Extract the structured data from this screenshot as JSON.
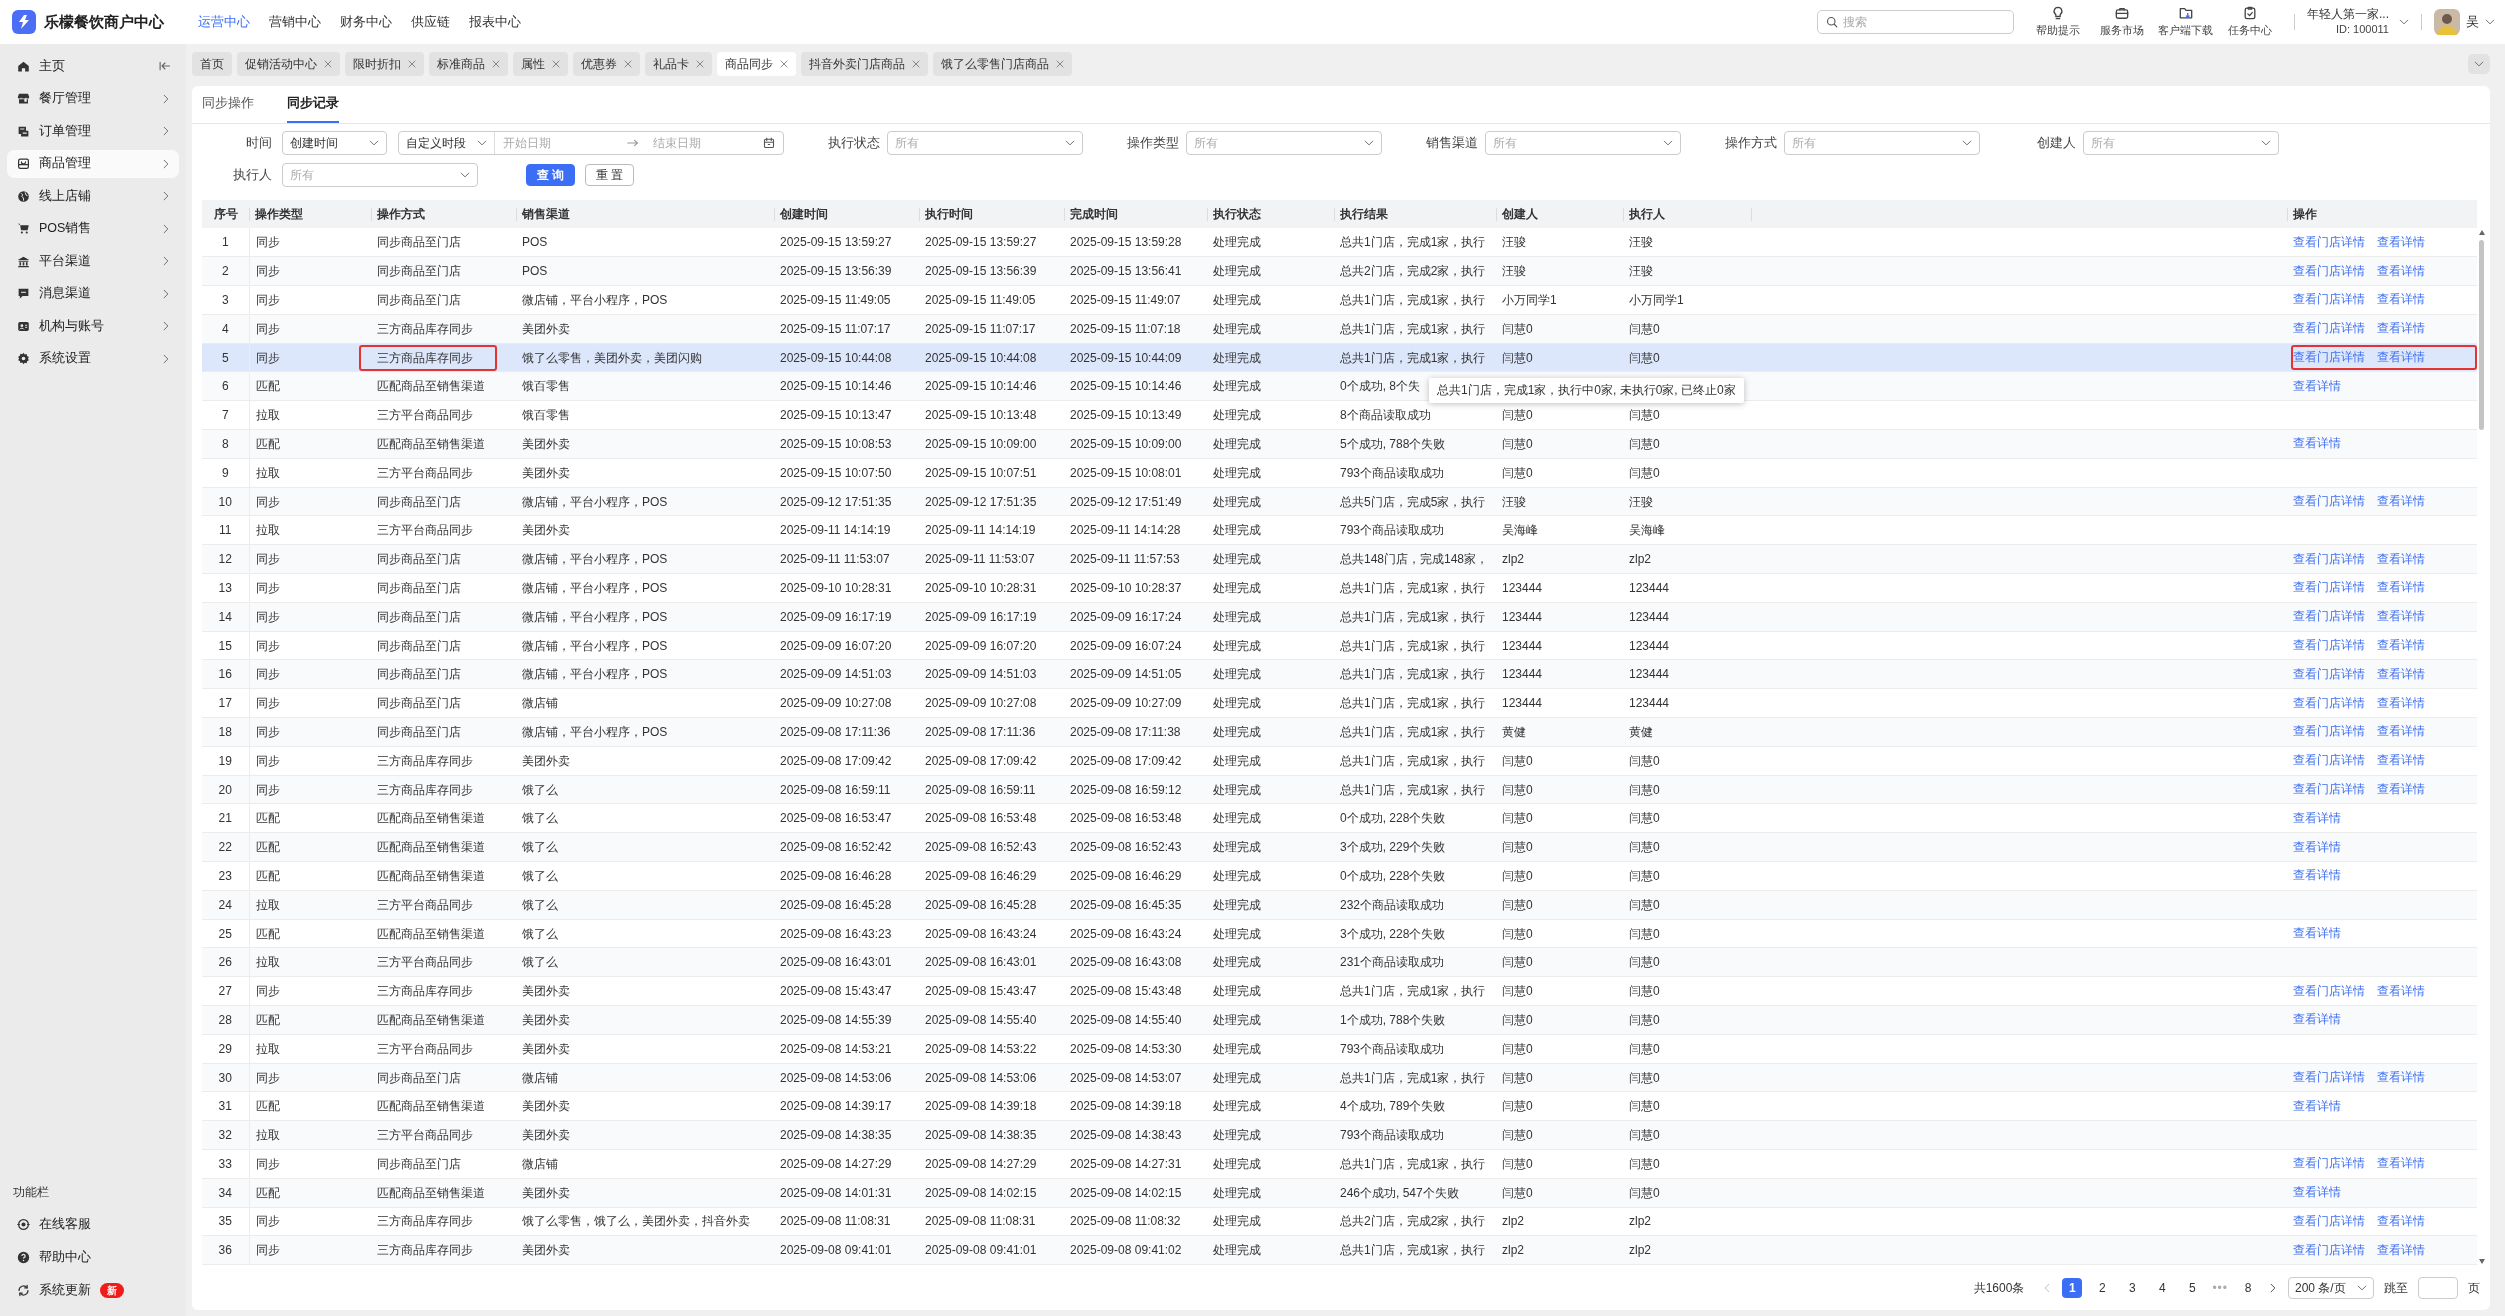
{
  "app": {
    "title": "乐檬餐饮商户中心"
  },
  "top_nav": [
    {
      "label": "运营中心",
      "selected": true
    },
    {
      "label": "营销中心",
      "selected": false
    },
    {
      "label": "财务中心",
      "selected": false
    },
    {
      "label": "供应链",
      "selected": false
    },
    {
      "label": "报表中心",
      "selected": false
    }
  ],
  "search": {
    "placeholder": "搜索"
  },
  "toolbar": [
    {
      "label": "帮助提示",
      "kind": "bulb"
    },
    {
      "label": "服务市场",
      "kind": "bag"
    },
    {
      "label": "客户端下载",
      "kind": "download"
    },
    {
      "label": "任务中心",
      "kind": "task"
    }
  ],
  "account": {
    "name": "年轻人第一家...",
    "id": "ID: 100011"
  },
  "user": {
    "name": "吴"
  },
  "sidebar": {
    "items": [
      {
        "label": "主页",
        "kind": "home",
        "selected": false,
        "chevron": false
      },
      {
        "label": "餐厅管理",
        "kind": "store",
        "selected": false,
        "chevron": true
      },
      {
        "label": "订单管理",
        "kind": "order",
        "selected": false,
        "chevron": true
      },
      {
        "label": "商品管理",
        "kind": "goods",
        "selected": true,
        "chevron": true
      },
      {
        "label": "线上店铺",
        "kind": "globe",
        "selected": false,
        "chevron": true
      },
      {
        "label": "POS销售",
        "kind": "cart",
        "selected": false,
        "chevron": true
      },
      {
        "label": "平台渠道",
        "kind": "bank",
        "selected": false,
        "chevron": true
      },
      {
        "label": "消息渠道",
        "kind": "chat",
        "selected": false,
        "chevron": true
      },
      {
        "label": "机构与账号",
        "kind": "idcard",
        "selected": false,
        "chevron": true
      },
      {
        "label": "系统设置",
        "kind": "gear",
        "selected": false,
        "chevron": true
      }
    ],
    "footer_title": "功能栏",
    "footer_items": [
      {
        "label": "在线客服",
        "kind": "service"
      },
      {
        "label": "帮助中心",
        "kind": "help"
      },
      {
        "label": "系统更新",
        "kind": "update",
        "badge": "新"
      }
    ]
  },
  "page_tabs": [
    {
      "label": "首页",
      "closable": false,
      "selected": false
    },
    {
      "label": "促销活动中心",
      "closable": true,
      "selected": false
    },
    {
      "label": "限时折扣",
      "closable": true,
      "selected": false
    },
    {
      "label": "标准商品",
      "closable": true,
      "selected": false
    },
    {
      "label": "属性",
      "closable": true,
      "selected": false
    },
    {
      "label": "优惠券",
      "closable": true,
      "selected": false
    },
    {
      "label": "礼品卡",
      "closable": true,
      "selected": false
    },
    {
      "label": "商品同步",
      "closable": true,
      "selected": true
    },
    {
      "label": "抖音外卖门店商品",
      "closable": true,
      "selected": false
    },
    {
      "label": "饿了么零售门店商品",
      "closable": true,
      "selected": false
    }
  ],
  "sub_tabs": [
    {
      "label": "同步操作",
      "selected": false
    },
    {
      "label": "同步记录",
      "selected": true
    }
  ],
  "filter_rows": [
    [
      {
        "label": "时间",
        "kind": "daterange",
        "value": "创建时间",
        "range_type": "自定义时段",
        "start_placeholder": "开始日期",
        "end_placeholder": "结束日期"
      },
      {
        "label": "执行状态",
        "kind": "select",
        "placeholder": "所有"
      },
      {
        "label": "操作类型",
        "kind": "select",
        "placeholder": "所有"
      },
      {
        "label": "销售渠道",
        "kind": "select",
        "placeholder": "所有"
      },
      {
        "label": "操作方式",
        "kind": "select",
        "placeholder": "所有"
      },
      {
        "label": "创建人",
        "kind": "select",
        "placeholder": "所有"
      }
    ],
    [
      {
        "label": "执行人",
        "kind": "select",
        "placeholder": "所有"
      }
    ]
  ],
  "filter_buttons": [
    {
      "label": "查 询",
      "kind": "primary"
    },
    {
      "label": "重 置",
      "kind": "default"
    }
  ],
  "table": {
    "columns": [
      "序号",
      "操作类型",
      "操作方式",
      "销售渠道",
      "创建时间",
      "执行时间",
      "完成时间",
      "执行状态",
      "执行结果",
      "创建人",
      "执行人",
      "操作"
    ],
    "rows": [
      {
        "no": "1",
        "type": "同步",
        "mode": "同步商品至门店",
        "channel": "POS",
        "created": "2025-09-15 13:59:27",
        "executed": "2025-09-15 13:59:27",
        "completed": "2025-09-15 13:59:28",
        "status": "处理完成",
        "result": "总共1门店，完成1家，执行",
        "creator": "汪骏",
        "executor": "汪骏",
        "actions": [
          "查看门店详情",
          "查看详情"
        ],
        "selected": false,
        "boxed": false
      },
      {
        "no": "2",
        "type": "同步",
        "mode": "同步商品至门店",
        "channel": "POS",
        "created": "2025-09-15 13:56:39",
        "executed": "2025-09-15 13:56:39",
        "completed": "2025-09-15 13:56:41",
        "status": "处理完成",
        "result": "总共2门店，完成2家，执行",
        "creator": "汪骏",
        "executor": "汪骏",
        "actions": [
          "查看门店详情",
          "查看详情"
        ],
        "selected": false,
        "boxed": false
      },
      {
        "no": "3",
        "type": "同步",
        "mode": "同步商品至门店",
        "channel": "微店铺，平台小程序，POS",
        "created": "2025-09-15 11:49:05",
        "executed": "2025-09-15 11:49:05",
        "completed": "2025-09-15 11:49:07",
        "status": "处理完成",
        "result": "总共1门店，完成1家，执行",
        "creator": "小万同学1",
        "executor": "小万同学1",
        "actions": [
          "查看门店详情",
          "查看详情"
        ],
        "selected": false,
        "boxed": false
      },
      {
        "no": "4",
        "type": "同步",
        "mode": "三方商品库存同步",
        "channel": "美团外卖",
        "created": "2025-09-15 11:07:17",
        "executed": "2025-09-15 11:07:17",
        "completed": "2025-09-15 11:07:18",
        "status": "处理完成",
        "result": "总共1门店，完成1家，执行",
        "creator": "闫慧0",
        "executor": "闫慧0",
        "actions": [
          "查看门店详情",
          "查看详情"
        ],
        "selected": false,
        "boxed": false
      },
      {
        "no": "5",
        "type": "同步",
        "mode": "三方商品库存同步",
        "channel": "饿了么零售，美团外卖，美团闪购",
        "created": "2025-09-15 10:44:08",
        "executed": "2025-09-15 10:44:08",
        "completed": "2025-09-15 10:44:09",
        "status": "处理完成",
        "result": "总共1门店，完成1家，执行",
        "creator": "闫慧0",
        "executor": "闫慧0",
        "actions": [
          "查看门店详情",
          "查看详情"
        ],
        "selected": true,
        "boxed": true
      },
      {
        "no": "6",
        "type": "匹配",
        "mode": "匹配商品至销售渠道",
        "channel": "饿百零售",
        "created": "2025-09-15 10:14:46",
        "executed": "2025-09-15 10:14:46",
        "completed": "2025-09-15 10:14:46",
        "status": "处理完成",
        "result": "0个成功, 8个失",
        "tooltip": "总共1门店，完成1家，执行中0家, 未执行0家, 已终止0家",
        "actions": [
          "查看详情"
        ],
        "selected": false,
        "boxed": false
      },
      {
        "no": "7",
        "type": "拉取",
        "mode": "三方平台商品同步",
        "channel": "饿百零售",
        "created": "2025-09-15 10:13:47",
        "executed": "2025-09-15 10:13:48",
        "completed": "2025-09-15 10:13:49",
        "status": "处理完成",
        "result": "8个商品读取成功",
        "creator": "闫慧0",
        "executor": "闫慧0",
        "actions": [],
        "selected": false,
        "boxed": false
      },
      {
        "no": "8",
        "type": "匹配",
        "mode": "匹配商品至销售渠道",
        "channel": "美团外卖",
        "created": "2025-09-15 10:08:53",
        "executed": "2025-09-15 10:09:00",
        "completed": "2025-09-15 10:09:00",
        "status": "处理完成",
        "result": "5个成功, 788个失败",
        "creator": "闫慧0",
        "executor": "闫慧0",
        "actions": [
          "查看详情"
        ],
        "selected": false,
        "boxed": false
      },
      {
        "no": "9",
        "type": "拉取",
        "mode": "三方平台商品同步",
        "channel": "美团外卖",
        "created": "2025-09-15 10:07:50",
        "executed": "2025-09-15 10:07:51",
        "completed": "2025-09-15 10:08:01",
        "status": "处理完成",
        "result": "793个商品读取成功",
        "creator": "闫慧0",
        "executor": "闫慧0",
        "actions": [],
        "selected": false,
        "boxed": false
      },
      {
        "no": "10",
        "type": "同步",
        "mode": "同步商品至门店",
        "channel": "微店铺，平台小程序，POS",
        "created": "2025-09-12 17:51:35",
        "executed": "2025-09-12 17:51:35",
        "completed": "2025-09-12 17:51:49",
        "status": "处理完成",
        "result": "总共5门店，完成5家，执行",
        "creator": "汪骏",
        "executor": "汪骏",
        "actions": [
          "查看门店详情",
          "查看详情"
        ],
        "selected": false,
        "boxed": false
      },
      {
        "no": "11",
        "type": "拉取",
        "mode": "三方平台商品同步",
        "channel": "美团外卖",
        "created": "2025-09-11 14:14:19",
        "executed": "2025-09-11 14:14:19",
        "completed": "2025-09-11 14:14:28",
        "status": "处理完成",
        "result": "793个商品读取成功",
        "creator": "吴海峰",
        "executor": "吴海峰",
        "actions": [],
        "selected": false,
        "boxed": false
      },
      {
        "no": "12",
        "type": "同步",
        "mode": "同步商品至门店",
        "channel": "微店铺，平台小程序，POS",
        "created": "2025-09-11 11:53:07",
        "executed": "2025-09-11 11:53:07",
        "completed": "2025-09-11 11:57:53",
        "status": "处理完成",
        "result": "总共148门店，完成148家，",
        "creator": "zlp2",
        "executor": "zlp2",
        "actions": [
          "查看门店详情",
          "查看详情"
        ],
        "selected": false,
        "boxed": false
      },
      {
        "no": "13",
        "type": "同步",
        "mode": "同步商品至门店",
        "channel": "微店铺，平台小程序，POS",
        "created": "2025-09-10 10:28:31",
        "executed": "2025-09-10 10:28:31",
        "completed": "2025-09-10 10:28:37",
        "status": "处理完成",
        "result": "总共1门店，完成1家，执行",
        "creator": "123444",
        "executor": "123444",
        "actions": [
          "查看门店详情",
          "查看详情"
        ],
        "selected": false,
        "boxed": false
      },
      {
        "no": "14",
        "type": "同步",
        "mode": "同步商品至门店",
        "channel": "微店铺，平台小程序，POS",
        "created": "2025-09-09 16:17:19",
        "executed": "2025-09-09 16:17:19",
        "completed": "2025-09-09 16:17:24",
        "status": "处理完成",
        "result": "总共1门店，完成1家，执行",
        "creator": "123444",
        "executor": "123444",
        "actions": [
          "查看门店详情",
          "查看详情"
        ],
        "selected": false,
        "boxed": false
      },
      {
        "no": "15",
        "type": "同步",
        "mode": "同步商品至门店",
        "channel": "微店铺，平台小程序，POS",
        "created": "2025-09-09 16:07:20",
        "executed": "2025-09-09 16:07:20",
        "completed": "2025-09-09 16:07:24",
        "status": "处理完成",
        "result": "总共1门店，完成1家，执行",
        "creator": "123444",
        "executor": "123444",
        "actions": [
          "查看门店详情",
          "查看详情"
        ],
        "selected": false,
        "boxed": false
      },
      {
        "no": "16",
        "type": "同步",
        "mode": "同步商品至门店",
        "channel": "微店铺，平台小程序，POS",
        "created": "2025-09-09 14:51:03",
        "executed": "2025-09-09 14:51:03",
        "completed": "2025-09-09 14:51:05",
        "status": "处理完成",
        "result": "总共1门店，完成1家，执行",
        "creator": "123444",
        "executor": "123444",
        "actions": [
          "查看门店详情",
          "查看详情"
        ],
        "selected": false,
        "boxed": false
      },
      {
        "no": "17",
        "type": "同步",
        "mode": "同步商品至门店",
        "channel": "微店铺",
        "created": "2025-09-09 10:27:08",
        "executed": "2025-09-09 10:27:08",
        "completed": "2025-09-09 10:27:09",
        "status": "处理完成",
        "result": "总共1门店，完成1家，执行",
        "creator": "123444",
        "executor": "123444",
        "actions": [
          "查看门店详情",
          "查看详情"
        ],
        "selected": false,
        "boxed": false
      },
      {
        "no": "18",
        "type": "同步",
        "mode": "同步商品至门店",
        "channel": "微店铺，平台小程序，POS",
        "created": "2025-09-08 17:11:36",
        "executed": "2025-09-08 17:11:36",
        "completed": "2025-09-08 17:11:38",
        "status": "处理完成",
        "result": "总共1门店，完成1家，执行",
        "creator": "黄健",
        "executor": "黄健",
        "actions": [
          "查看门店详情",
          "查看详情"
        ],
        "selected": false,
        "boxed": false
      },
      {
        "no": "19",
        "type": "同步",
        "mode": "三方商品库存同步",
        "channel": "美团外卖",
        "created": "2025-09-08 17:09:42",
        "executed": "2025-09-08 17:09:42",
        "completed": "2025-09-08 17:09:42",
        "status": "处理完成",
        "result": "总共1门店，完成1家，执行",
        "creator": "闫慧0",
        "executor": "闫慧0",
        "actions": [
          "查看门店详情",
          "查看详情"
        ],
        "selected": false,
        "boxed": false
      },
      {
        "no": "20",
        "type": "同步",
        "mode": "三方商品库存同步",
        "channel": "饿了么",
        "created": "2025-09-08 16:59:11",
        "executed": "2025-09-08 16:59:11",
        "completed": "2025-09-08 16:59:12",
        "status": "处理完成",
        "result": "总共1门店，完成1家，执行",
        "creator": "闫慧0",
        "executor": "闫慧0",
        "actions": [
          "查看门店详情",
          "查看详情"
        ],
        "selected": false,
        "boxed": false
      },
      {
        "no": "21",
        "type": "匹配",
        "mode": "匹配商品至销售渠道",
        "channel": "饿了么",
        "created": "2025-09-08 16:53:47",
        "executed": "2025-09-08 16:53:48",
        "completed": "2025-09-08 16:53:48",
        "status": "处理完成",
        "result": "0个成功, 228个失败",
        "creator": "闫慧0",
        "executor": "闫慧0",
        "actions": [
          "查看详情"
        ],
        "selected": false,
        "boxed": false
      },
      {
        "no": "22",
        "type": "匹配",
        "mode": "匹配商品至销售渠道",
        "channel": "饿了么",
        "created": "2025-09-08 16:52:42",
        "executed": "2025-09-08 16:52:43",
        "completed": "2025-09-08 16:52:43",
        "status": "处理完成",
        "result": "3个成功, 229个失败",
        "creator": "闫慧0",
        "executor": "闫慧0",
        "actions": [
          "查看详情"
        ],
        "selected": false,
        "boxed": false
      },
      {
        "no": "23",
        "type": "匹配",
        "mode": "匹配商品至销售渠道",
        "channel": "饿了么",
        "created": "2025-09-08 16:46:28",
        "executed": "2025-09-08 16:46:29",
        "completed": "2025-09-08 16:46:29",
        "status": "处理完成",
        "result": "0个成功, 228个失败",
        "creator": "闫慧0",
        "executor": "闫慧0",
        "actions": [
          "查看详情"
        ],
        "selected": false,
        "boxed": false
      },
      {
        "no": "24",
        "type": "拉取",
        "mode": "三方平台商品同步",
        "channel": "饿了么",
        "created": "2025-09-08 16:45:28",
        "executed": "2025-09-08 16:45:28",
        "completed": "2025-09-08 16:45:35",
        "status": "处理完成",
        "result": "232个商品读取成功",
        "creator": "闫慧0",
        "executor": "闫慧0",
        "actions": [],
        "selected": false,
        "boxed": false
      },
      {
        "no": "25",
        "type": "匹配",
        "mode": "匹配商品至销售渠道",
        "channel": "饿了么",
        "created": "2025-09-08 16:43:23",
        "executed": "2025-09-08 16:43:24",
        "completed": "2025-09-08 16:43:24",
        "status": "处理完成",
        "result": "3个成功, 228个失败",
        "creator": "闫慧0",
        "executor": "闫慧0",
        "actions": [
          "查看详情"
        ],
        "selected": false,
        "boxed": false
      },
      {
        "no": "26",
        "type": "拉取",
        "mode": "三方平台商品同步",
        "channel": "饿了么",
        "created": "2025-09-08 16:43:01",
        "executed": "2025-09-08 16:43:01",
        "completed": "2025-09-08 16:43:08",
        "status": "处理完成",
        "result": "231个商品读取成功",
        "creator": "闫慧0",
        "executor": "闫慧0",
        "actions": [],
        "selected": false,
        "boxed": false
      },
      {
        "no": "27",
        "type": "同步",
        "mode": "三方商品库存同步",
        "channel": "美团外卖",
        "created": "2025-09-08 15:43:47",
        "executed": "2025-09-08 15:43:47",
        "completed": "2025-09-08 15:43:48",
        "status": "处理完成",
        "result": "总共1门店，完成1家，执行",
        "creator": "闫慧0",
        "executor": "闫慧0",
        "actions": [
          "查看门店详情",
          "查看详情"
        ],
        "selected": false,
        "boxed": false
      },
      {
        "no": "28",
        "type": "匹配",
        "mode": "匹配商品至销售渠道",
        "channel": "美团外卖",
        "created": "2025-09-08 14:55:39",
        "executed": "2025-09-08 14:55:40",
        "completed": "2025-09-08 14:55:40",
        "status": "处理完成",
        "result": "1个成功, 788个失败",
        "creator": "闫慧0",
        "executor": "闫慧0",
        "actions": [
          "查看详情"
        ],
        "selected": false,
        "boxed": false
      },
      {
        "no": "29",
        "type": "拉取",
        "mode": "三方平台商品同步",
        "channel": "美团外卖",
        "created": "2025-09-08 14:53:21",
        "executed": "2025-09-08 14:53:22",
        "completed": "2025-09-08 14:53:30",
        "status": "处理完成",
        "result": "793个商品读取成功",
        "creator": "闫慧0",
        "executor": "闫慧0",
        "actions": [],
        "selected": false,
        "boxed": false
      },
      {
        "no": "30",
        "type": "同步",
        "mode": "同步商品至门店",
        "channel": "微店铺",
        "created": "2025-09-08 14:53:06",
        "executed": "2025-09-08 14:53:06",
        "completed": "2025-09-08 14:53:07",
        "status": "处理完成",
        "result": "总共1门店，完成1家，执行",
        "creator": "闫慧0",
        "executor": "闫慧0",
        "actions": [
          "查看门店详情",
          "查看详情"
        ],
        "selected": false,
        "boxed": false
      },
      {
        "no": "31",
        "type": "匹配",
        "mode": "匹配商品至销售渠道",
        "channel": "美团外卖",
        "created": "2025-09-08 14:39:17",
        "executed": "2025-09-08 14:39:18",
        "completed": "2025-09-08 14:39:18",
        "status": "处理完成",
        "result": "4个成功, 789个失败",
        "creator": "闫慧0",
        "executor": "闫慧0",
        "actions": [
          "查看详情"
        ],
        "selected": false,
        "boxed": false
      },
      {
        "no": "32",
        "type": "拉取",
        "mode": "三方平台商品同步",
        "channel": "美团外卖",
        "created": "2025-09-08 14:38:35",
        "executed": "2025-09-08 14:38:35",
        "completed": "2025-09-08 14:38:43",
        "status": "处理完成",
        "result": "793个商品读取成功",
        "creator": "闫慧0",
        "executor": "闫慧0",
        "actions": [],
        "selected": false,
        "boxed": false
      },
      {
        "no": "33",
        "type": "同步",
        "mode": "同步商品至门店",
        "channel": "微店铺",
        "created": "2025-09-08 14:27:29",
        "executed": "2025-09-08 14:27:29",
        "completed": "2025-09-08 14:27:31",
        "status": "处理完成",
        "result": "总共1门店，完成1家，执行",
        "creator": "闫慧0",
        "executor": "闫慧0",
        "actions": [
          "查看门店详情",
          "查看详情"
        ],
        "selected": false,
        "boxed": false
      },
      {
        "no": "34",
        "type": "匹配",
        "mode": "匹配商品至销售渠道",
        "channel": "美团外卖",
        "created": "2025-09-08 14:01:31",
        "executed": "2025-09-08 14:02:15",
        "completed": "2025-09-08 14:02:15",
        "status": "处理完成",
        "result": "246个成功, 547个失败",
        "creator": "闫慧0",
        "executor": "闫慧0",
        "actions": [
          "查看详情"
        ],
        "selected": false,
        "boxed": false
      },
      {
        "no": "35",
        "type": "同步",
        "mode": "三方商品库存同步",
        "channel": "饿了么零售，饿了么，美团外卖，抖音外卖",
        "created": "2025-09-08 11:08:31",
        "executed": "2025-09-08 11:08:31",
        "completed": "2025-09-08 11:08:32",
        "status": "处理完成",
        "result": "总共2门店，完成2家，执行",
        "creator": "zlp2",
        "executor": "zlp2",
        "actions": [
          "查看门店详情",
          "查看详情"
        ],
        "selected": false,
        "boxed": false
      },
      {
        "no": "36",
        "type": "同步",
        "mode": "三方商品库存同步",
        "channel": "美团外卖",
        "created": "2025-09-08 09:41:01",
        "executed": "2025-09-08 09:41:01",
        "completed": "2025-09-08 09:41:02",
        "status": "处理完成",
        "result": "总共1门店，完成1家，执行",
        "creator": "zlp2",
        "executor": "zlp2",
        "actions": [
          "查看门店详情",
          "查看详情"
        ],
        "selected": false,
        "boxed": false
      }
    ]
  },
  "pagination": {
    "total": "共1600条",
    "pages": [
      {
        "label": "1",
        "kind": "page",
        "selected": true
      },
      {
        "label": "2",
        "kind": "page",
        "selected": false
      },
      {
        "label": "3",
        "kind": "page",
        "selected": false
      },
      {
        "label": "4",
        "kind": "page",
        "selected": false
      },
      {
        "label": "5",
        "kind": "page",
        "selected": false
      },
      {
        "label": "•••",
        "kind": "ellipsis"
      },
      {
        "label": "8",
        "kind": "page",
        "selected": false
      }
    ],
    "page_size": "200 条/页",
    "jump_label": "跳至",
    "page_suffix": "页"
  }
}
